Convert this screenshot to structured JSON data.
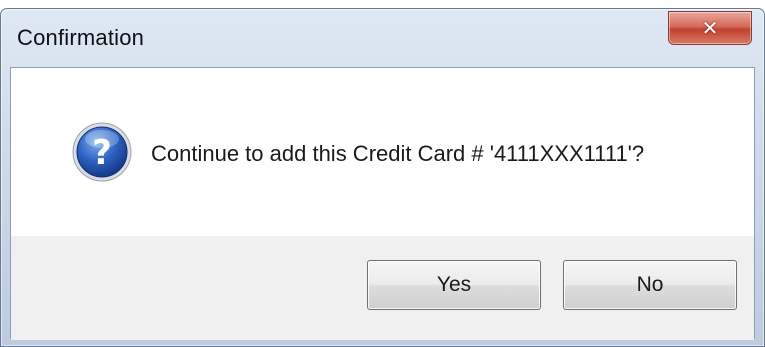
{
  "window": {
    "title": "Confirmation",
    "close_glyph": "✕"
  },
  "message": {
    "icon": "question-icon",
    "text": "Continue to add this Credit Card # '4111XXX1111'?"
  },
  "buttons": {
    "yes_label": "Yes",
    "no_label": "No"
  },
  "colors": {
    "icon_blue": "#1f4fa8",
    "close_red": "#c2412f"
  }
}
